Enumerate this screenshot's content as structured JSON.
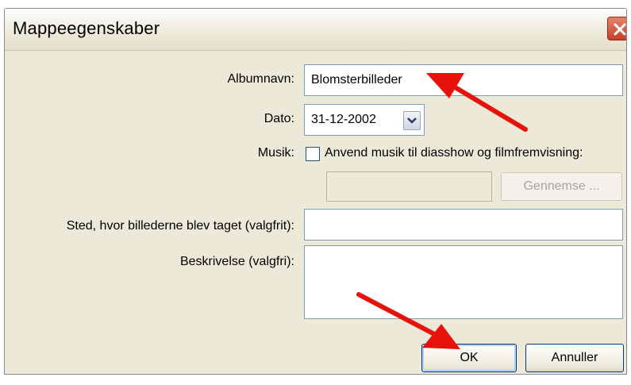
{
  "window": {
    "title": "Mappeegenskaber",
    "close_icon": "close-icon"
  },
  "form": {
    "album_name_label": "Albumnavn:",
    "album_name_value": "Blomsterbilleder",
    "date_label": "Dato:",
    "date_value": "31-12-2002",
    "music_label": "Musik:",
    "music_checkbox_label": "Anvend musik til diasshow og filmfremvisning:",
    "music_checked": false,
    "browse_label": "Gennemse ...",
    "location_label": "Sted, hvor billederne blev taget (valgfrit):",
    "location_value": "",
    "description_label": "Beskrivelse (valgfri):",
    "description_value": ""
  },
  "buttons": {
    "ok_label": "OK",
    "cancel_label": "Annuller"
  },
  "colors": {
    "dialog_bg": "#ece9d8",
    "annotation_arrow": "#e8120c",
    "close_button": "#c6402a"
  }
}
